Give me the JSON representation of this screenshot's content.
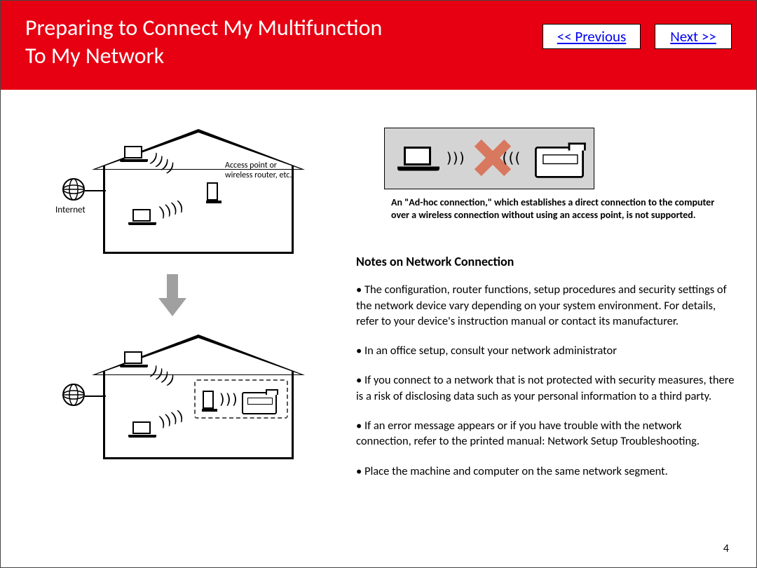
{
  "header": {
    "title_line1": "Preparing to Connect My Multifunction",
    "title_line2": "To My Network",
    "prev_label": "<< Previous",
    "next_label": "Next >>"
  },
  "left_diagram": {
    "internet_label": "Internet",
    "ap_label_line1": "Access point or",
    "ap_label_line2": "wireless router, etc."
  },
  "adhoc": {
    "note": "An \"Ad-hoc connection,\" which establishes a direct connection to the computer over a wireless connection without using an access point, is not supported."
  },
  "notes": {
    "heading": "Notes on Network Connection",
    "items": [
      "• The configuration, router functions, setup procedures and security settings of the network device vary depending on your system environment. For details, refer to your device's instruction manual or contact its manufacturer.",
      "• In an office setup, consult your network administrator",
      "• If you connect to a network that is not protected with security measures, there is a risk of disclosing data such as your personal information to a third party.",
      "• If an error message appears or if you have trouble with the network connection, refer to the printed manual: Network Setup Troubleshooting.",
      "• Place the machine and computer on the same network segment."
    ]
  },
  "page_number": "4"
}
